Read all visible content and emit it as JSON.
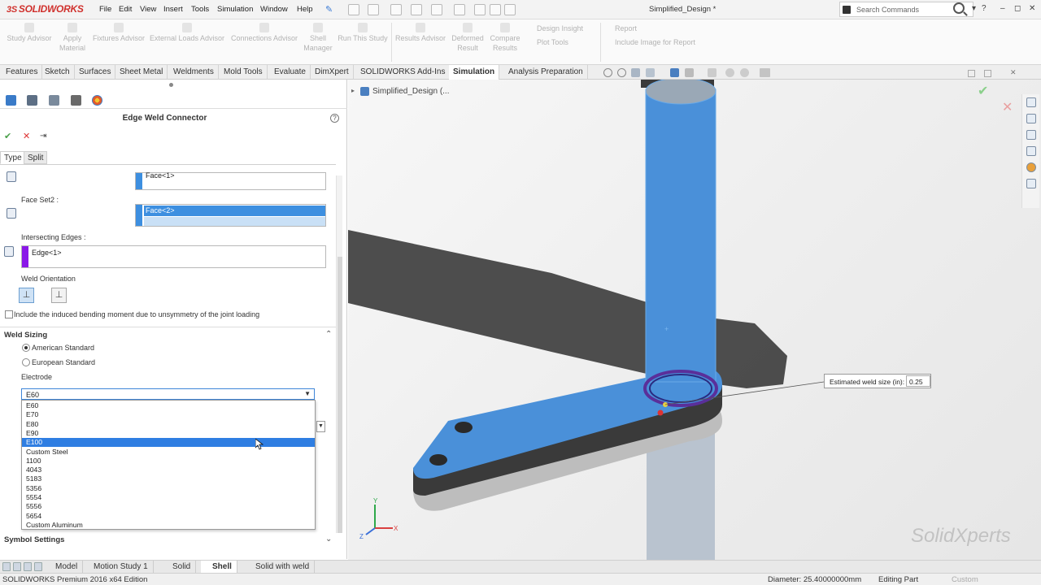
{
  "titlebar": {
    "app_name": "SOLIDWORKS",
    "menus": [
      "File",
      "Edit",
      "View",
      "Insert",
      "Tools",
      "Simulation",
      "Window",
      "Help"
    ],
    "document_title": "Simplified_Design *",
    "search_placeholder": "Search Commands"
  },
  "command_manager": {
    "items": [
      {
        "label": "Study Advisor",
        "icon": "study-advisor-icon"
      },
      {
        "label": "Apply Material",
        "icon": "apply-material-icon"
      },
      {
        "label": "Fixtures Advisor",
        "icon": "fixtures-icon"
      },
      {
        "label": "External Loads Advisor",
        "icon": "loads-icon"
      },
      {
        "label": "Connections Advisor",
        "icon": "connections-icon"
      },
      {
        "label": "Shell Manager",
        "icon": "shell-manager-icon"
      },
      {
        "label": "Run This Study",
        "icon": "run-study-icon"
      },
      {
        "label": "Results Advisor",
        "icon": "results-advisor-icon"
      },
      {
        "label": "Deformed Result",
        "icon": "deformed-result-icon"
      },
      {
        "label": "Compare Results",
        "icon": "compare-results-icon"
      }
    ],
    "side_items": [
      "Design Insight",
      "Plot Tools",
      "Report",
      "Include Image for Report"
    ]
  },
  "tabs": [
    "Features",
    "Sketch",
    "Surfaces",
    "Sheet Metal",
    "Weldments",
    "Mold Tools",
    "Evaluate",
    "DimXpert",
    "SOLIDWORKS Add-Ins",
    "Simulation",
    "Analysis Preparation"
  ],
  "active_tab": "Simulation",
  "property_manager": {
    "title": "Edge Weld Connector",
    "subtabs": [
      "Type",
      "Split"
    ],
    "face_set1_value": "Face<1>",
    "face_set2_label": "Face Set2 :",
    "face_set2_value": "Face<2>",
    "intersecting_edges_label": "Intersecting Edges :",
    "intersecting_edges_value": "Edge<1>",
    "weld_orientation_label": "Weld Orientation",
    "include_bending_label": "Include the induced bending moment due to unsymmetry of the joint loading",
    "weld_sizing_label": "Weld Sizing",
    "standards": [
      "American Standard",
      "European Standard"
    ],
    "electrode_label": "Electrode",
    "electrode_value": "E60",
    "electrode_options": [
      "E60",
      "E70",
      "E80",
      "E90",
      "E100",
      "Custom Steel",
      "1100",
      "4043",
      "5183",
      "5356",
      "5554",
      "5556",
      "5654",
      "Custom Aluminum"
    ],
    "highlighted_option": "E100",
    "symbol_settings_label": "Symbol Settings"
  },
  "viewport": {
    "breadcrumb": "Simplified_Design  (...",
    "weld_tag_label": "Estimated weld size (in):",
    "weld_tag_value": "0.25",
    "watermark": "SolidXperts",
    "triad": {
      "x": "X",
      "y": "Y",
      "z": "Z"
    }
  },
  "bottom_tabs": [
    "Model",
    "Motion Study 1",
    "Solid",
    "Shell",
    "Solid with weld"
  ],
  "active_bottom_tab": "Shell",
  "status": {
    "edition": "SOLIDWORKS Premium 2016 x64 Edition",
    "diameter": "Diameter: 25.40000000mm",
    "mode": "Editing Part",
    "units": "Custom"
  },
  "colors": {
    "part_blue": "#4a90d9",
    "dark_gray": "#3a3a3a",
    "weld_purple": "#5a2f9a",
    "selection_blue": "#2f7ee2"
  }
}
